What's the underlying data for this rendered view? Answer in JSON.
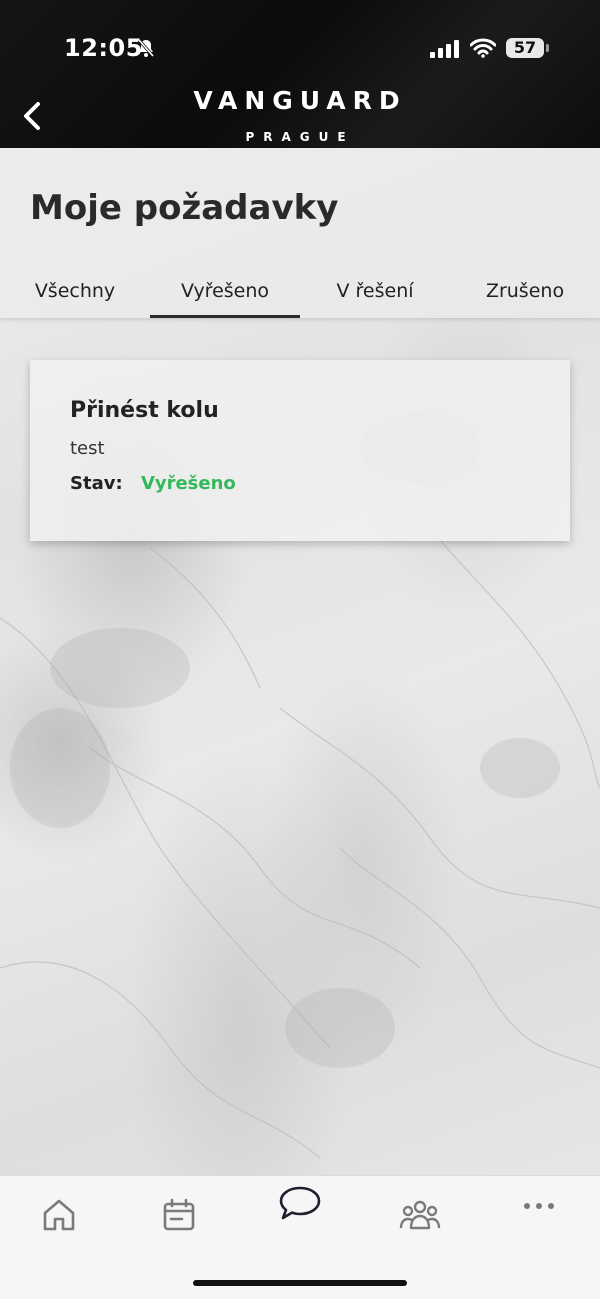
{
  "status_bar": {
    "time": "12:05",
    "battery": "57",
    "icons": [
      "bell-slash-icon",
      "signal-icon",
      "wifi-icon",
      "battery-icon"
    ]
  },
  "header": {
    "brand": "VANGUARD",
    "subbrand": "PRAGUE",
    "back_icon": "chevron-left-icon"
  },
  "page": {
    "title": "Moje požadavky"
  },
  "tabs": [
    {
      "label": "Všechny",
      "active": false
    },
    {
      "label": "Vyřešeno",
      "active": true
    },
    {
      "label": "V řešení",
      "active": false
    },
    {
      "label": "Zrušeno",
      "active": false
    }
  ],
  "requests": [
    {
      "title": "Přinést kolu",
      "description": "test",
      "status_label": "Stav:",
      "status_value": "Vyřešeno",
      "status_color": "#34b85a"
    }
  ],
  "bottom_nav": {
    "items": [
      {
        "icon": "home-icon"
      },
      {
        "icon": "calendar-icon"
      },
      {
        "icon": "chat-bubble-icon",
        "active": true
      },
      {
        "icon": "people-icon"
      },
      {
        "icon": "more-dots-icon"
      }
    ]
  },
  "colors": {
    "header_bg": "#111111",
    "accent_green": "#34b85a",
    "text_dark": "#222222"
  }
}
